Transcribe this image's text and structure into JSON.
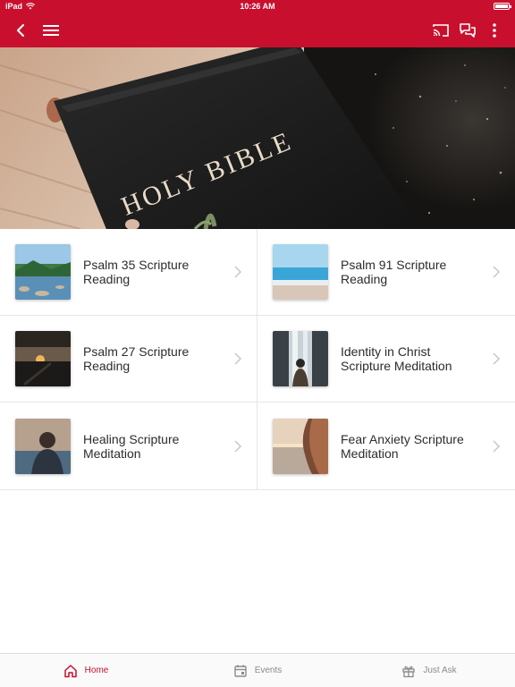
{
  "status_bar": {
    "device": "iPad",
    "time": "10:26 AM"
  },
  "nav": {
    "back_icon": "chevron-left-icon",
    "menu_icon": "hamburger-icon",
    "cast_icon": "cast-icon",
    "chat_icon": "chat-bubbles-icon",
    "more_icon": "more-vertical-icon"
  },
  "hero": {
    "image": "holy-bible-photo",
    "cover_text": "HOLY BIBLE"
  },
  "items": [
    {
      "label": "Psalm 35 Scripture Reading",
      "thumb": "lake-landscape"
    },
    {
      "label": "Psalm 91 Scripture Reading",
      "thumb": "ocean-beach"
    },
    {
      "label": "Psalm 27 Scripture Reading",
      "thumb": "sunset-dock"
    },
    {
      "label": "Identity in Christ Scripture Meditation",
      "thumb": "person-waterfall"
    },
    {
      "label": "Healing Scripture Meditation",
      "thumb": "woman-lake-silhouette"
    },
    {
      "label": "Fear Anxiety Scripture Meditation",
      "thumb": "woman-sea-sunset"
    }
  ],
  "tabs": [
    {
      "label": "Home",
      "icon": "home-icon",
      "active": true
    },
    {
      "label": "Events",
      "icon": "calendar-icon",
      "active": false
    },
    {
      "label": "Just Ask",
      "icon": "gift-icon",
      "active": false
    }
  ],
  "colors": {
    "brand": "#c8102e",
    "text": "#2c2c2c",
    "tab_inactive": "#8a8a8a"
  }
}
